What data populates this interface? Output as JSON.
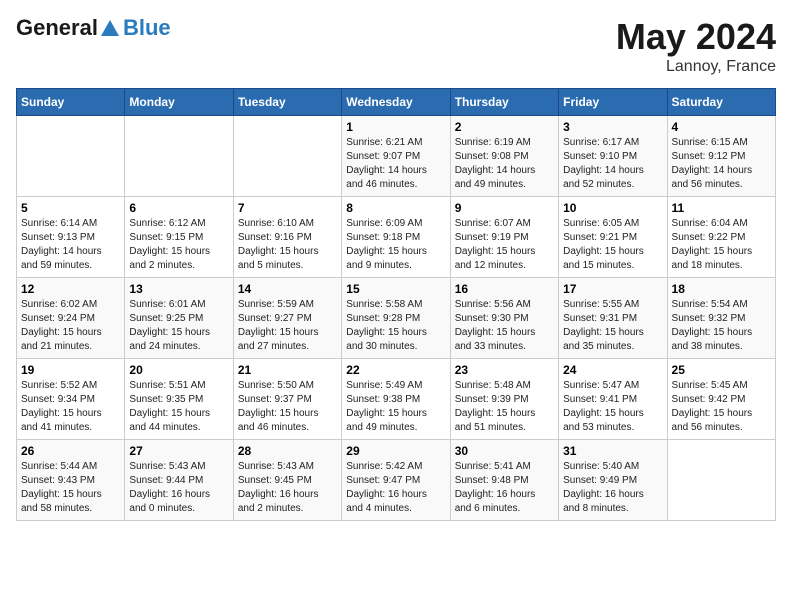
{
  "header": {
    "logo_line1": "General",
    "logo_line2": "Blue",
    "month_year": "May 2024",
    "location": "Lannoy, France"
  },
  "columns": [
    "Sunday",
    "Monday",
    "Tuesday",
    "Wednesday",
    "Thursday",
    "Friday",
    "Saturday"
  ],
  "weeks": [
    [
      {
        "day": "",
        "content": ""
      },
      {
        "day": "",
        "content": ""
      },
      {
        "day": "",
        "content": ""
      },
      {
        "day": "1",
        "content": "Sunrise: 6:21 AM\nSunset: 9:07 PM\nDaylight: 14 hours and 46 minutes."
      },
      {
        "day": "2",
        "content": "Sunrise: 6:19 AM\nSunset: 9:08 PM\nDaylight: 14 hours and 49 minutes."
      },
      {
        "day": "3",
        "content": "Sunrise: 6:17 AM\nSunset: 9:10 PM\nDaylight: 14 hours and 52 minutes."
      },
      {
        "day": "4",
        "content": "Sunrise: 6:15 AM\nSunset: 9:12 PM\nDaylight: 14 hours and 56 minutes."
      }
    ],
    [
      {
        "day": "5",
        "content": "Sunrise: 6:14 AM\nSunset: 9:13 PM\nDaylight: 14 hours and 59 minutes."
      },
      {
        "day": "6",
        "content": "Sunrise: 6:12 AM\nSunset: 9:15 PM\nDaylight: 15 hours and 2 minutes."
      },
      {
        "day": "7",
        "content": "Sunrise: 6:10 AM\nSunset: 9:16 PM\nDaylight: 15 hours and 5 minutes."
      },
      {
        "day": "8",
        "content": "Sunrise: 6:09 AM\nSunset: 9:18 PM\nDaylight: 15 hours and 9 minutes."
      },
      {
        "day": "9",
        "content": "Sunrise: 6:07 AM\nSunset: 9:19 PM\nDaylight: 15 hours and 12 minutes."
      },
      {
        "day": "10",
        "content": "Sunrise: 6:05 AM\nSunset: 9:21 PM\nDaylight: 15 hours and 15 minutes."
      },
      {
        "day": "11",
        "content": "Sunrise: 6:04 AM\nSunset: 9:22 PM\nDaylight: 15 hours and 18 minutes."
      }
    ],
    [
      {
        "day": "12",
        "content": "Sunrise: 6:02 AM\nSunset: 9:24 PM\nDaylight: 15 hours and 21 minutes."
      },
      {
        "day": "13",
        "content": "Sunrise: 6:01 AM\nSunset: 9:25 PM\nDaylight: 15 hours and 24 minutes."
      },
      {
        "day": "14",
        "content": "Sunrise: 5:59 AM\nSunset: 9:27 PM\nDaylight: 15 hours and 27 minutes."
      },
      {
        "day": "15",
        "content": "Sunrise: 5:58 AM\nSunset: 9:28 PM\nDaylight: 15 hours and 30 minutes."
      },
      {
        "day": "16",
        "content": "Sunrise: 5:56 AM\nSunset: 9:30 PM\nDaylight: 15 hours and 33 minutes."
      },
      {
        "day": "17",
        "content": "Sunrise: 5:55 AM\nSunset: 9:31 PM\nDaylight: 15 hours and 35 minutes."
      },
      {
        "day": "18",
        "content": "Sunrise: 5:54 AM\nSunset: 9:32 PM\nDaylight: 15 hours and 38 minutes."
      }
    ],
    [
      {
        "day": "19",
        "content": "Sunrise: 5:52 AM\nSunset: 9:34 PM\nDaylight: 15 hours and 41 minutes."
      },
      {
        "day": "20",
        "content": "Sunrise: 5:51 AM\nSunset: 9:35 PM\nDaylight: 15 hours and 44 minutes."
      },
      {
        "day": "21",
        "content": "Sunrise: 5:50 AM\nSunset: 9:37 PM\nDaylight: 15 hours and 46 minutes."
      },
      {
        "day": "22",
        "content": "Sunrise: 5:49 AM\nSunset: 9:38 PM\nDaylight: 15 hours and 49 minutes."
      },
      {
        "day": "23",
        "content": "Sunrise: 5:48 AM\nSunset: 9:39 PM\nDaylight: 15 hours and 51 minutes."
      },
      {
        "day": "24",
        "content": "Sunrise: 5:47 AM\nSunset: 9:41 PM\nDaylight: 15 hours and 53 minutes."
      },
      {
        "day": "25",
        "content": "Sunrise: 5:45 AM\nSunset: 9:42 PM\nDaylight: 15 hours and 56 minutes."
      }
    ],
    [
      {
        "day": "26",
        "content": "Sunrise: 5:44 AM\nSunset: 9:43 PM\nDaylight: 15 hours and 58 minutes."
      },
      {
        "day": "27",
        "content": "Sunrise: 5:43 AM\nSunset: 9:44 PM\nDaylight: 16 hours and 0 minutes."
      },
      {
        "day": "28",
        "content": "Sunrise: 5:43 AM\nSunset: 9:45 PM\nDaylight: 16 hours and 2 minutes."
      },
      {
        "day": "29",
        "content": "Sunrise: 5:42 AM\nSunset: 9:47 PM\nDaylight: 16 hours and 4 minutes."
      },
      {
        "day": "30",
        "content": "Sunrise: 5:41 AM\nSunset: 9:48 PM\nDaylight: 16 hours and 6 minutes."
      },
      {
        "day": "31",
        "content": "Sunrise: 5:40 AM\nSunset: 9:49 PM\nDaylight: 16 hours and 8 minutes."
      },
      {
        "day": "",
        "content": ""
      }
    ]
  ]
}
